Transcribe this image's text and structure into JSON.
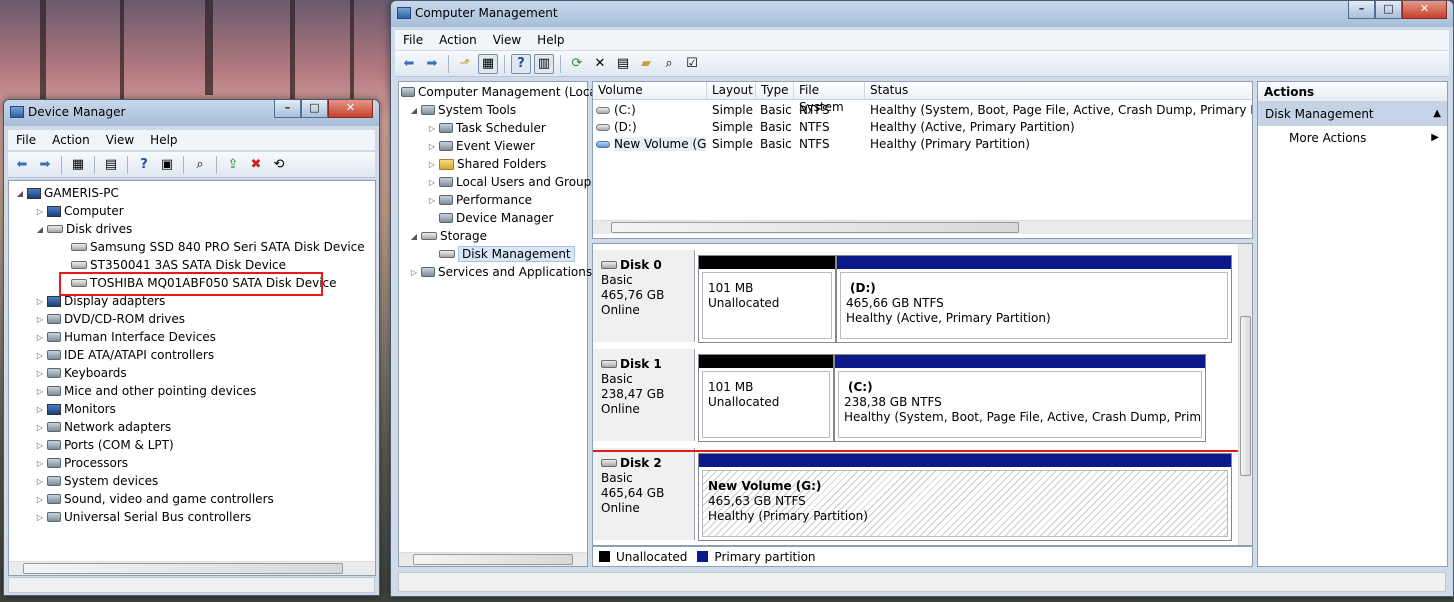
{
  "device_manager": {
    "title": "Device Manager",
    "menu": [
      "File",
      "Action",
      "View",
      "Help"
    ],
    "root": "GAMERIS-PC",
    "tree": [
      {
        "label": "Computer",
        "level": 1,
        "icon": "computer-icon",
        "expanded": false
      },
      {
        "label": "Disk drives",
        "level": 1,
        "icon": "disk-drive-icon",
        "expanded": true
      },
      {
        "label": "Samsung SSD 840 PRO Seri SATA Disk Device",
        "level": 2,
        "icon": "disk-drive-icon"
      },
      {
        "label": "ST350041 3AS SATA Disk Device",
        "level": 2,
        "icon": "disk-drive-icon"
      },
      {
        "label": "TOSHIBA MQ01ABF050 SATA Disk Device",
        "level": 2,
        "icon": "disk-drive-icon",
        "highlighted": true
      },
      {
        "label": "Display adapters",
        "level": 1,
        "icon": "display-adapter-icon",
        "expanded": false
      },
      {
        "label": "DVD/CD-ROM drives",
        "level": 1,
        "icon": "dvd-drive-icon",
        "expanded": false
      },
      {
        "label": "Human Interface Devices",
        "level": 1,
        "icon": "hid-icon",
        "expanded": false
      },
      {
        "label": "IDE ATA/ATAPI controllers",
        "level": 1,
        "icon": "ide-controller-icon",
        "expanded": false
      },
      {
        "label": "Keyboards",
        "level": 1,
        "icon": "keyboard-icon",
        "expanded": false
      },
      {
        "label": "Mice and other pointing devices",
        "level": 1,
        "icon": "mouse-icon",
        "expanded": false
      },
      {
        "label": "Monitors",
        "level": 1,
        "icon": "monitor-icon",
        "expanded": false
      },
      {
        "label": "Network adapters",
        "level": 1,
        "icon": "network-adapter-icon",
        "expanded": false
      },
      {
        "label": "Ports (COM & LPT)",
        "level": 1,
        "icon": "port-icon",
        "expanded": false
      },
      {
        "label": "Processors",
        "level": 1,
        "icon": "processor-icon",
        "expanded": false
      },
      {
        "label": "System devices",
        "level": 1,
        "icon": "system-device-icon",
        "expanded": false
      },
      {
        "label": "Sound, video and game controllers",
        "level": 1,
        "icon": "sound-icon",
        "expanded": false
      },
      {
        "label": "Universal Serial Bus controllers",
        "level": 1,
        "icon": "usb-icon",
        "expanded": false
      }
    ]
  },
  "computer_management": {
    "title": "Computer Management",
    "menu": [
      "File",
      "Action",
      "View",
      "Help"
    ],
    "nav": [
      {
        "label": "Computer Management (Local",
        "level": 0,
        "icon": "computer-management-icon"
      },
      {
        "label": "System Tools",
        "level": 1,
        "icon": "tools-icon",
        "expanded": true
      },
      {
        "label": "Task Scheduler",
        "level": 2,
        "icon": "clock-icon"
      },
      {
        "label": "Event Viewer",
        "level": 2,
        "icon": "event-viewer-icon"
      },
      {
        "label": "Shared Folders",
        "level": 2,
        "icon": "shared-folder-icon"
      },
      {
        "label": "Local Users and Groups",
        "level": 2,
        "icon": "users-icon"
      },
      {
        "label": "Performance",
        "level": 2,
        "icon": "performance-icon"
      },
      {
        "label": "Device Manager",
        "level": 2,
        "icon": "device-manager-icon"
      },
      {
        "label": "Storage",
        "level": 1,
        "icon": "storage-icon",
        "expanded": true
      },
      {
        "label": "Disk Management",
        "level": 2,
        "icon": "disk-management-icon",
        "selected": true
      },
      {
        "label": "Services and Applications",
        "level": 1,
        "icon": "services-icon",
        "expanded": false
      }
    ],
    "volume_columns": [
      "Volume",
      "Layout",
      "Type",
      "File System",
      "Status"
    ],
    "volumes": [
      {
        "volume": "(C:)",
        "layout": "Simple",
        "type": "Basic",
        "fs": "NTFS",
        "status": "Healthy (System, Boot, Page File, Active, Crash Dump, Primary Partition)"
      },
      {
        "volume": "(D:)",
        "layout": "Simple",
        "type": "Basic",
        "fs": "NTFS",
        "status": "Healthy (Active, Primary Partition)"
      },
      {
        "volume": "New Volume (G:)",
        "layout": "Simple",
        "type": "Basic",
        "fs": "NTFS",
        "status": "Healthy (Primary Partition)"
      }
    ],
    "disks": [
      {
        "name": "Disk 0",
        "type": "Basic",
        "size": "465,76 GB",
        "state": "Online",
        "unalloc": {
          "size": "101 MB",
          "label": "Unallocated"
        },
        "partition": {
          "name": "(D:)",
          "size": "465,66 GB NTFS",
          "status": "Healthy (Active, Primary Partition)"
        }
      },
      {
        "name": "Disk 1",
        "type": "Basic",
        "size": "238,47 GB",
        "state": "Online",
        "unalloc": {
          "size": "101 MB",
          "label": "Unallocated"
        },
        "partition": {
          "name": "(C:)",
          "size": "238,38 GB NTFS",
          "status": "Healthy (System, Boot, Page File, Active, Crash Dump, Primary Parti"
        }
      },
      {
        "name": "Disk 2",
        "type": "Basic",
        "size": "465,64 GB",
        "state": "Online",
        "partition": {
          "name": "New Volume  (G:)",
          "size": "465,63 GB NTFS",
          "status": "Healthy (Primary Partition)"
        }
      }
    ],
    "legend": [
      "Unallocated",
      "Primary partition"
    ],
    "actions": {
      "header": "Actions",
      "section": "Disk Management",
      "items": [
        "More Actions"
      ]
    }
  },
  "colors": {
    "highlight": "#e31b1b",
    "primary_partition": "#0a1a8a",
    "unallocated": "#000000",
    "actions_header": "#c4d3e6"
  }
}
